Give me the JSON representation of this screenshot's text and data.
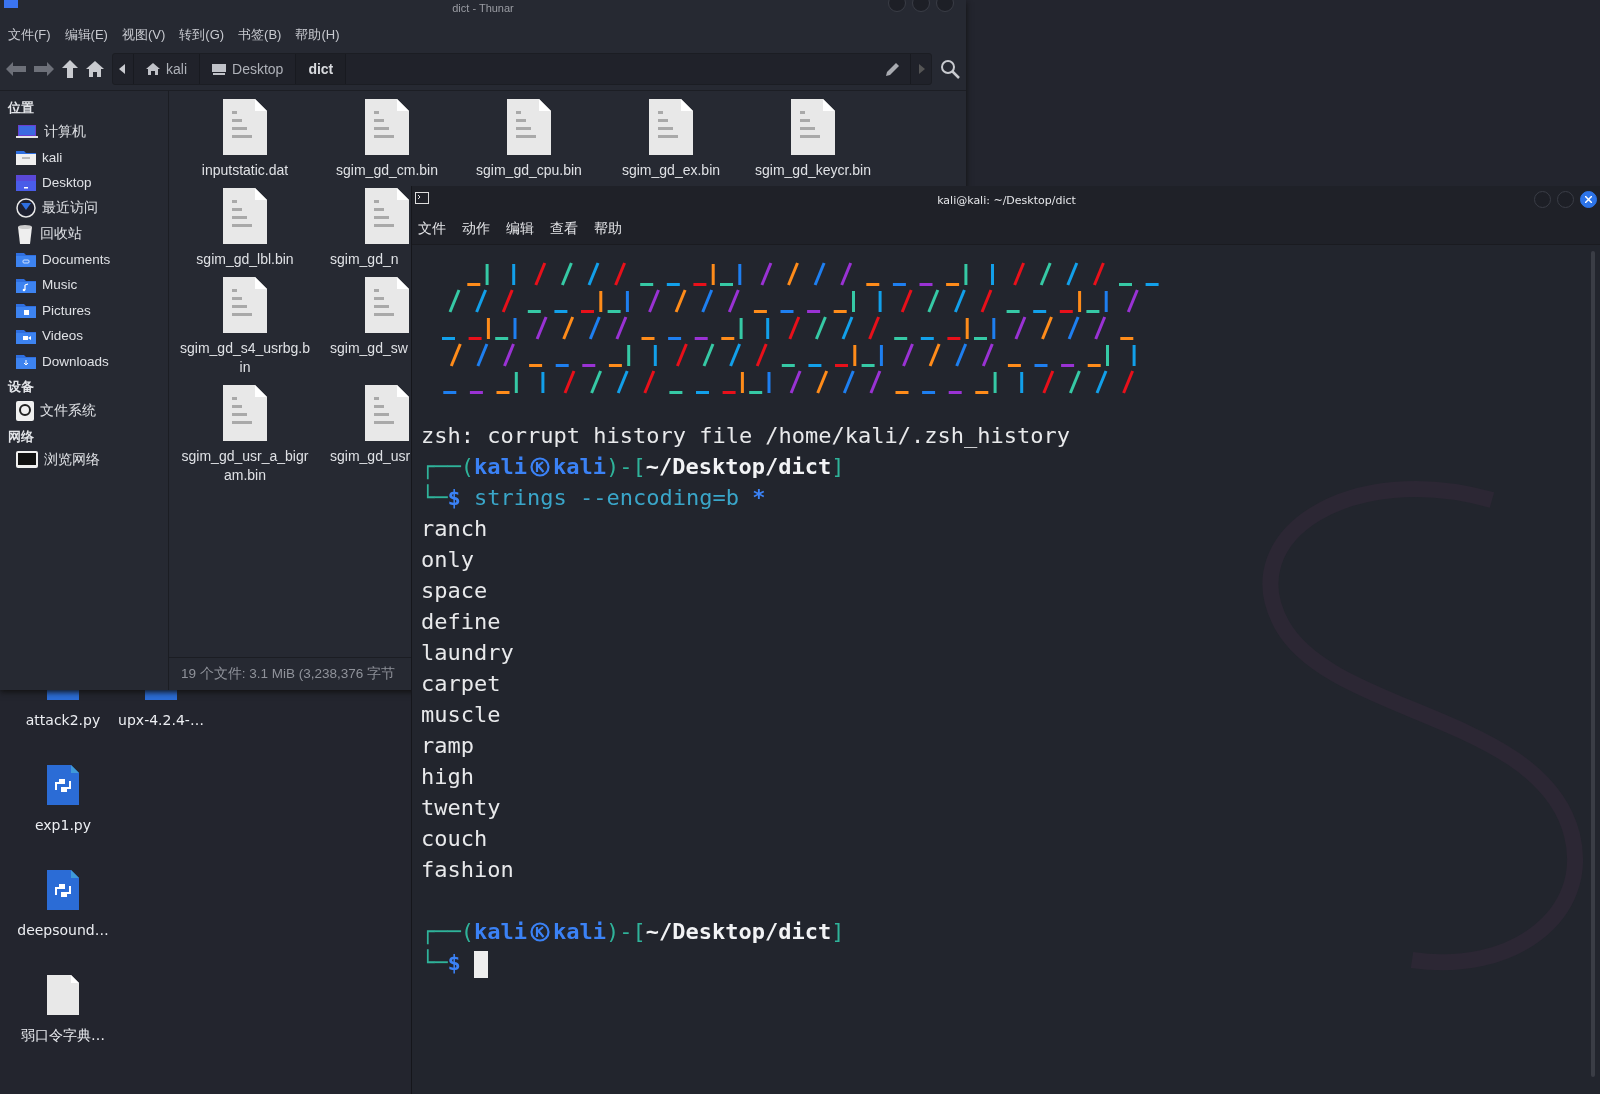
{
  "file_manager": {
    "title": "dict - Thunar",
    "menu": [
      "文件(F)",
      "编辑(E)",
      "视图(V)",
      "转到(G)",
      "书签(B)",
      "帮助(H)"
    ],
    "path": [
      {
        "label": "kali",
        "kind": "home",
        "selected": false
      },
      {
        "label": "Desktop",
        "kind": "desktop",
        "selected": false
      },
      {
        "label": "dict",
        "kind": "folder",
        "selected": true
      }
    ],
    "sidebar": [
      {
        "heading": "位置",
        "items": [
          {
            "label": "计算机",
            "kind": "computer"
          },
          {
            "label": "kali",
            "kind": "home"
          },
          {
            "label": "Desktop",
            "kind": "desktop"
          },
          {
            "label": "最近访问",
            "kind": "recent"
          },
          {
            "label": "回收站",
            "kind": "trash"
          },
          {
            "label": "Documents",
            "kind": "documents"
          },
          {
            "label": "Music",
            "kind": "music"
          },
          {
            "label": "Pictures",
            "kind": "pictures"
          },
          {
            "label": "Videos",
            "kind": "videos"
          },
          {
            "label": "Downloads",
            "kind": "downloads"
          }
        ]
      },
      {
        "heading": "设备",
        "items": [
          {
            "label": "文件系统",
            "kind": "drive"
          }
        ]
      },
      {
        "heading": "网络",
        "items": [
          {
            "label": "浏览网络",
            "kind": "network"
          }
        ]
      }
    ],
    "files": [
      {
        "name": "inputstatic.dat",
        "clipped": false
      },
      {
        "name": "sgim_gd_cm.bin",
        "clipped": false
      },
      {
        "name": "sgim_gd_cpu.bin",
        "clipped": false
      },
      {
        "name": "sgim_gd_ex.bin",
        "clipped": false
      },
      {
        "name": "sgim_gd_keycr.bin",
        "clipped": false
      },
      {
        "name": "sgim_gd_lbl.bin",
        "clipped": false
      },
      {
        "name": "sgim_gd_n",
        "clipped": true
      },
      {
        "name": "sgim_gd_s4_usrbg.bin",
        "clipped": false
      },
      {
        "name": "sgim_gd_sw",
        "clipped": true
      },
      {
        "name": "sgim_gd_usr_a_bigram.bin",
        "clipped": false
      },
      {
        "name": "sgim_gd_usr",
        "clipped": true
      }
    ],
    "status": "19 个文件: 3.1 MiB (3,238,376 字节"
  },
  "desktop_icons": [
    {
      "label": "attack2.py",
      "kind": "python"
    },
    {
      "label": "upx-4.2.4-…",
      "kind": "archive"
    },
    {
      "label": "exp1.py",
      "kind": "python"
    },
    {
      "label": "deepsound…",
      "kind": "python"
    },
    {
      "label": "弱口令字典…",
      "kind": "text"
    }
  ],
  "terminal": {
    "title": "kali@kali: ~/Desktop/dict",
    "menu": [
      "文件",
      "动作",
      "编辑",
      "查看",
      "帮助"
    ],
    "lines": [
      {
        "kind": "text",
        "text": "zsh: corrupt history file /home/kali/.zsh_history"
      },
      {
        "kind": "prompt",
        "open": "┌──(",
        "user": "kali",
        "host": "kali",
        "mid": ")-[",
        "path": "~/Desktop/dict",
        "close": "]"
      },
      {
        "kind": "command",
        "lead": "└─",
        "sign": "$",
        "tokens": [
          {
            "kind": "cmd",
            "text": "strings"
          },
          {
            "kind": "arg",
            "text": "--encoding=b"
          },
          {
            "kind": "glob",
            "text": "*"
          }
        ]
      },
      {
        "kind": "text",
        "text": "ranch"
      },
      {
        "kind": "text",
        "text": "only"
      },
      {
        "kind": "text",
        "text": "space"
      },
      {
        "kind": "text",
        "text": "define"
      },
      {
        "kind": "text",
        "text": "laundry"
      },
      {
        "kind": "text",
        "text": "carpet"
      },
      {
        "kind": "text",
        "text": "muscle"
      },
      {
        "kind": "text",
        "text": "ramp"
      },
      {
        "kind": "text",
        "text": "high"
      },
      {
        "kind": "text",
        "text": "twenty"
      },
      {
        "kind": "text",
        "text": "couch"
      },
      {
        "kind": "text",
        "text": "fashion"
      },
      {
        "kind": "blank"
      },
      {
        "kind": "prompt",
        "open": "┌──(",
        "user": "kali",
        "host": "kali",
        "mid": ")-[",
        "path": "~/Desktop/dict",
        "close": "]"
      },
      {
        "kind": "input",
        "lead": "└─",
        "sign": "$"
      }
    ]
  }
}
